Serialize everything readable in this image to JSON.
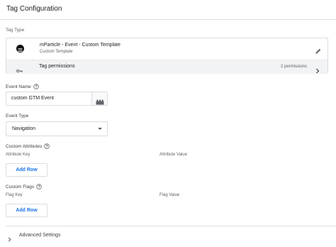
{
  "header": {
    "title": "Tag Configuration"
  },
  "tag_type": {
    "section_label": "Tag Type",
    "name": "mParticle - Event - Custom Template",
    "subtitle": "Custom Template",
    "permissions_label": "Tag permissions",
    "permissions_count": "2 permissions"
  },
  "event_name": {
    "label": "Event Name",
    "value": "custom GTM Event"
  },
  "event_type": {
    "label": "Event Type",
    "value": "Navigation"
  },
  "custom_attributes": {
    "label": "Custom Attributes",
    "key_header": "Attribute Key",
    "value_header": "Attribute Value",
    "add_label": "Add Row"
  },
  "custom_flags": {
    "label": "Custom Flags",
    "key_header": "Flag Key",
    "value_header": "Flag Value",
    "add_label": "Add Row"
  },
  "advanced": {
    "label": "Advanced Settings"
  },
  "colors": {
    "accent": "#1a73e8",
    "border": "#dadce0",
    "muted": "#5f6368"
  }
}
